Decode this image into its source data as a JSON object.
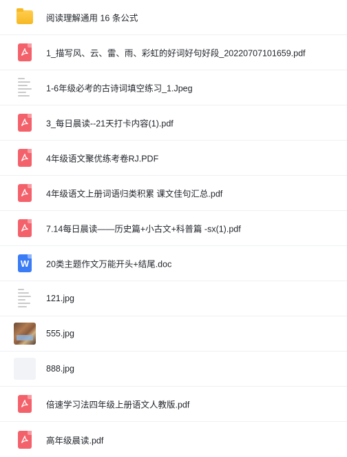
{
  "files": [
    {
      "name": "阅读理解通用 16 条公式",
      "icon": "folder-icon"
    },
    {
      "name": "1_描写风、云、雷、雨、彩虹的好词好句好段_20220707101659.pdf",
      "icon": "pdf-icon"
    },
    {
      "name": "1-6年级必考的古诗词填空练习_1.Jpeg",
      "icon": "image-thumbnail-icon"
    },
    {
      "name": "3_每日晨读--21天打卡内容(1).pdf",
      "icon": "pdf-icon"
    },
    {
      "name": "4年级语文聚优练考卷RJ.PDF",
      "icon": "pdf-icon"
    },
    {
      "name": "4年级语文上册词语归类积累 课文佳句汇总.pdf",
      "icon": "pdf-icon"
    },
    {
      "name": "7.14每日晨读——历史篇+小古文+科普篇 -sx(1).pdf",
      "icon": "pdf-icon"
    },
    {
      "name": "20类主题作文万能开头+结尾.doc",
      "icon": "word-doc-icon",
      "glyph": "W"
    },
    {
      "name": "121.jpg",
      "icon": "image-thumbnail-icon"
    },
    {
      "name": "555.jpg",
      "icon": "photo-thumbnail-icon"
    },
    {
      "name": "888.jpg",
      "icon": "blank-thumbnail-icon"
    },
    {
      "name": "倍速学习法四年级上册语文人教版.pdf",
      "icon": "pdf-icon"
    },
    {
      "name": "高年级晨读.pdf",
      "icon": "pdf-icon"
    }
  ],
  "colors": {
    "pdf": "#f3626b",
    "doc": "#3a7bf6",
    "folder": "#f6b924"
  }
}
